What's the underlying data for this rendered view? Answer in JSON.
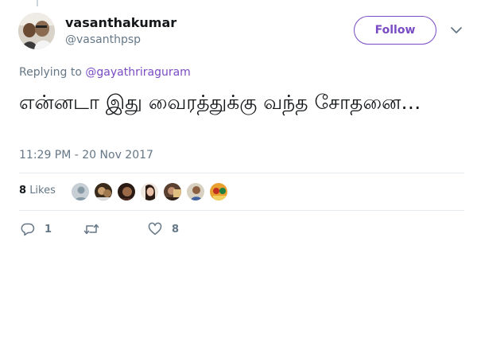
{
  "user": {
    "display_name": "vasanthakumar",
    "screen_name": "@vasanthpsp",
    "avatar_icon": "user-avatar-photo"
  },
  "follow_button": {
    "label": "Follow"
  },
  "menu": {
    "icon": "chevron-down-icon"
  },
  "reply_context": {
    "prefix": "Replying to",
    "mention": "@gayathriraguram"
  },
  "tweet": {
    "text": "என்னடா இது வைரத்துக்கு வந்த சோதனை…",
    "timestamp": "11:29 PM - 20 Nov 2017"
  },
  "stats": {
    "likes_count": "8",
    "likes_label": "Likes",
    "liker_avatars": 7
  },
  "actions": {
    "reply": {
      "icon": "reply-icon",
      "count": "1"
    },
    "retweet": {
      "icon": "retweet-icon",
      "count": ""
    },
    "like": {
      "icon": "heart-icon",
      "count": "8"
    }
  },
  "colors": {
    "accent": "#794bc4",
    "text": "#14171a",
    "muted": "#657786",
    "divider": "#e6ecf0"
  }
}
